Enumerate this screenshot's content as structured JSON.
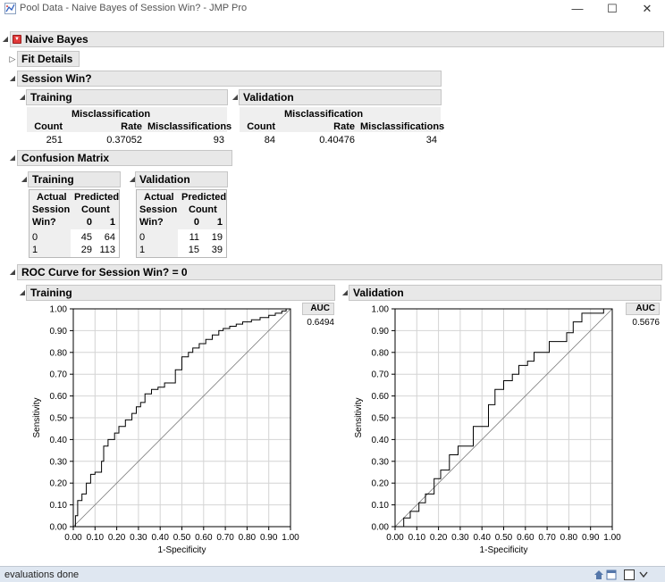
{
  "window": {
    "title": "Pool Data - Naive Bayes of Session Win? - JMP Pro",
    "minimize": "—",
    "maximize": "☐",
    "close": "✕"
  },
  "report": {
    "naive_bayes": "Naive Bayes",
    "fit_details": "Fit Details",
    "session_win": "Session Win?",
    "fit_tables": {
      "training": {
        "title": "Training",
        "h_count": "Count",
        "h_rate_1": "Misclassification",
        "h_rate_2": "Rate",
        "h_miscl": "Misclassifications",
        "count": "251",
        "rate": "0.37052",
        "misclassifications": "93"
      },
      "validation": {
        "title": "Validation",
        "h_count": "Count",
        "h_rate_1": "Misclassification",
        "h_rate_2": "Rate",
        "h_miscl": "Misclassifications",
        "count": "84",
        "rate": "0.40476",
        "misclassifications": "34"
      }
    },
    "confusion_matrix": {
      "title": "Confusion Matrix",
      "training": {
        "title": "Training",
        "h_actual": [
          "Actual",
          "Session",
          "Win?"
        ],
        "h_predicted": [
          "Predicted",
          "Count"
        ],
        "pred_levels": [
          "0",
          "1"
        ],
        "rows": [
          {
            "actual": "0",
            "c0": "45",
            "c1": "64"
          },
          {
            "actual": "1",
            "c0": "29",
            "c1": "113"
          }
        ]
      },
      "validation": {
        "title": "Validation",
        "h_actual": [
          "Actual",
          "Session",
          "Win?"
        ],
        "h_predicted": [
          "Predicted",
          "Count"
        ],
        "pred_levels": [
          "0",
          "1"
        ],
        "rows": [
          {
            "actual": "0",
            "c0": "11",
            "c1": "19"
          },
          {
            "actual": "1",
            "c0": "15",
            "c1": "39"
          }
        ]
      }
    },
    "roc": {
      "title": "ROC Curve for Session Win? = 0",
      "auc_label": "AUC"
    }
  },
  "chart_data": [
    {
      "type": "line",
      "title": "Training",
      "xlabel": "1-Specificity",
      "ylabel": "Sensitivity",
      "xlim": [
        0,
        1
      ],
      "ylim": [
        0,
        1
      ],
      "xticks": [
        "0.00",
        "0.10",
        "0.20",
        "0.30",
        "0.40",
        "0.50",
        "0.60",
        "0.70",
        "0.80",
        "0.90",
        "1.00"
      ],
      "yticks": [
        "0.00",
        "0.10",
        "0.20",
        "0.30",
        "0.40",
        "0.50",
        "0.60",
        "0.70",
        "0.80",
        "0.90",
        "1.00"
      ],
      "auc": "0.6494",
      "grid": true,
      "series": [
        {
          "x": [
            0,
            0.01,
            0.01,
            0.02,
            0.02,
            0.04,
            0.04,
            0.06,
            0.06,
            0.08,
            0.08,
            0.1,
            0.1,
            0.13,
            0.13,
            0.14,
            0.14,
            0.16,
            0.16,
            0.19,
            0.19,
            0.21,
            0.21,
            0.24,
            0.24,
            0.27,
            0.27,
            0.29,
            0.29,
            0.31,
            0.31,
            0.33,
            0.33,
            0.36,
            0.36,
            0.39,
            0.39,
            0.42,
            0.42,
            0.47,
            0.47,
            0.5,
            0.5,
            0.53,
            0.53,
            0.55,
            0.55,
            0.58,
            0.58,
            0.61,
            0.61,
            0.64,
            0.64,
            0.67,
            0.67,
            0.69,
            0.69,
            0.72,
            0.72,
            0.75,
            0.75,
            0.78,
            0.78,
            0.82,
            0.82,
            0.86,
            0.86,
            0.9,
            0.9,
            0.93,
            0.93,
            0.96,
            0.96,
            0.98,
            0.98,
            1.0
          ],
          "y": [
            0,
            0,
            0.05,
            0.05,
            0.12,
            0.12,
            0.15,
            0.15,
            0.2,
            0.2,
            0.24,
            0.24,
            0.25,
            0.25,
            0.3,
            0.3,
            0.37,
            0.37,
            0.4,
            0.4,
            0.43,
            0.43,
            0.46,
            0.46,
            0.49,
            0.49,
            0.52,
            0.52,
            0.55,
            0.55,
            0.57,
            0.57,
            0.61,
            0.61,
            0.63,
            0.63,
            0.64,
            0.64,
            0.66,
            0.66,
            0.72,
            0.72,
            0.78,
            0.78,
            0.8,
            0.8,
            0.82,
            0.82,
            0.84,
            0.84,
            0.86,
            0.86,
            0.88,
            0.88,
            0.9,
            0.9,
            0.91,
            0.91,
            0.92,
            0.92,
            0.93,
            0.93,
            0.94,
            0.94,
            0.95,
            0.95,
            0.96,
            0.96,
            0.97,
            0.97,
            0.98,
            0.98,
            0.99,
            0.99,
            1.0,
            1.0
          ]
        }
      ]
    },
    {
      "type": "line",
      "title": "Validation",
      "xlabel": "1-Specificity",
      "ylabel": "Sensitivity",
      "xlim": [
        0,
        1
      ],
      "ylim": [
        0,
        1
      ],
      "xticks": [
        "0.00",
        "0.10",
        "0.20",
        "0.30",
        "0.40",
        "0.50",
        "0.60",
        "0.70",
        "0.80",
        "0.90",
        "1.00"
      ],
      "yticks": [
        "0.00",
        "0.10",
        "0.20",
        "0.30",
        "0.40",
        "0.50",
        "0.60",
        "0.70",
        "0.80",
        "0.90",
        "1.00"
      ],
      "auc": "0.5676",
      "grid": true,
      "series": [
        {
          "x": [
            0,
            0.04,
            0.04,
            0.07,
            0.07,
            0.11,
            0.11,
            0.14,
            0.14,
            0.18,
            0.18,
            0.21,
            0.21,
            0.25,
            0.25,
            0.29,
            0.29,
            0.36,
            0.36,
            0.43,
            0.43,
            0.46,
            0.46,
            0.5,
            0.5,
            0.54,
            0.54,
            0.57,
            0.57,
            0.61,
            0.61,
            0.64,
            0.64,
            0.71,
            0.71,
            0.79,
            0.79,
            0.82,
            0.82,
            0.86,
            0.86,
            0.96,
            0.96,
            1.0
          ],
          "y": [
            0,
            0,
            0.04,
            0.04,
            0.07,
            0.07,
            0.11,
            0.11,
            0.15,
            0.15,
            0.22,
            0.22,
            0.26,
            0.26,
            0.33,
            0.33,
            0.37,
            0.37,
            0.46,
            0.46,
            0.56,
            0.56,
            0.63,
            0.63,
            0.67,
            0.67,
            0.7,
            0.7,
            0.74,
            0.74,
            0.76,
            0.76,
            0.8,
            0.8,
            0.85,
            0.85,
            0.89,
            0.89,
            0.94,
            0.94,
            0.98,
            0.98,
            1.0,
            1.0
          ]
        }
      ]
    }
  ],
  "status": {
    "text": "evaluations done"
  },
  "colors": {
    "header_bg": "#e8e8e8",
    "status_bg": "#dfe7f1",
    "red_button": "#e03a3a"
  }
}
